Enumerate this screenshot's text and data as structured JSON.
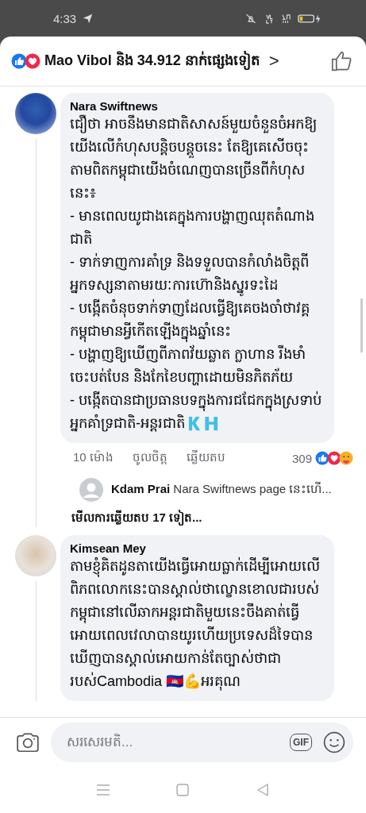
{
  "status_bar": {
    "time": "4:33"
  },
  "header": {
    "reactions_text": "Mao Vibol និង 34.912 នាក់ផ្សេងទៀត",
    "chevron": ">"
  },
  "comments": [
    {
      "author": "Nara Swiftnews",
      "paragraphs": [
        "ជឿថា អាចនឹងមានជាតិសាសន៍មួយចំនួនចំអកឱ្យយើងលើកំហុសបន្តិចបន្តួចនេះ តែឱ្យគេសើចចុះ តាមពិតកម្ពុជាយើងចំណេញបានច្រើនពីកំហុសនេះ៖",
        "-  មានពេលយូជាងគេក្នុងការបង្ហាញឈុតតំណាងជាតិ",
        "- ទាក់ទាញការគាំទ្រ និងទទួលបានកំលាំងចិត្តពីអ្នកទស្សនាតាមរយៈការហ៊ោនិងស្នូរទះដៃ",
        "-  បង្កើតចំនុចទាក់ទាញដែលធ្វើឱ្យគេចងចាំថាវគ្គកម្ពុជាមានអ្វីកើតឡើងក្នុងឆ្នាំនេះ",
        "- បង្ហាញឱ្យឃើញពីភាពវ័យឆ្លាត ក្លាហាន រឹងមាំចេះបត់បែន និងកែខៃបញ្ហាដោយមិនភិតភ័យ",
        "- បង្កើតបានជាប្រធានបទក្នុងការជជែកក្នុងស្រទាប់អ្នកគាំទ្រជាតិ-អន្តរជាតិ🇰🇭"
      ],
      "time": "10 ម៉ោង",
      "like": "ចូលចិត្ត",
      "reply": "ឆ្លើយតប",
      "reaction_count": "309",
      "replies": [
        {
          "author": "Kdam Prai",
          "text": "Nara Swiftnews page នេះហើ..."
        }
      ],
      "more_replies": "មើលការឆ្លើយតប 17 ទៀត..."
    },
    {
      "author": "Kimsean Mey",
      "paragraphs": [
        "តាមខ្ញុំគិតដូនតាយើងធ្វើអោយធ្លាក់ដើម្បីអោយលើពិភពលោកនេះបានស្គាល់ថាល្ខោនខោលជារបស់កម្ពុជានៅលើឆាកអន្តរជាតិមួយនេះចឹងគាត់ធ្វើអោយពេលវេលាបានយូរហើយប្រទេសដ៏ទៃបានឃើញបានស្គាល់អោយកាន់តែច្បាស់ថាជារបស់Cambodia 🇰🇭💪អរគុណ"
      ]
    }
  ],
  "composer": {
    "placeholder": "សរសេរមតិ...",
    "gif": "GIF"
  }
}
